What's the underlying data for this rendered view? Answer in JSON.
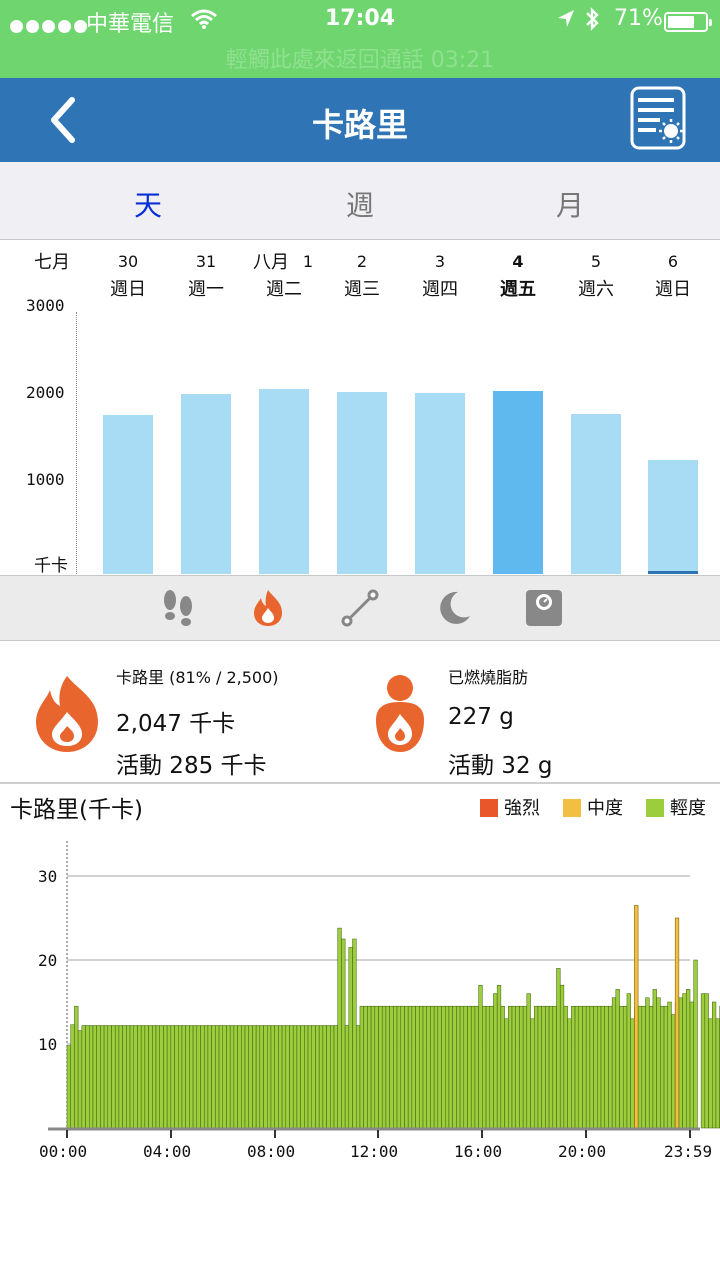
{
  "status_bar": {
    "carrier": "中華電信",
    "time": "17:04",
    "battery": "71%",
    "battery_level": 0.71,
    "call_banner": "輕觸此處來返回通話 03:21"
  },
  "header": {
    "title": "卡路里"
  },
  "tabs": [
    {
      "label": "天",
      "active": true
    },
    {
      "label": "週",
      "active": false
    },
    {
      "label": "月",
      "active": false
    }
  ],
  "week_chart": {
    "month_start": "七月",
    "month_mid": "八月",
    "days": [
      {
        "date": "30",
        "weekday": "週日"
      },
      {
        "date": "31",
        "weekday": "週一"
      },
      {
        "date": "1",
        "weekday": "週二"
      },
      {
        "date": "2",
        "weekday": "週三"
      },
      {
        "date": "3",
        "weekday": "週四"
      },
      {
        "date": "4",
        "weekday": "週五",
        "selected": true
      },
      {
        "date": "5",
        "weekday": "週六"
      },
      {
        "date": "6",
        "weekday": "週日"
      }
    ],
    "y_ticks": [
      "3000",
      "2000",
      "1000"
    ],
    "unit": "千卡"
  },
  "chart_data": [
    {
      "type": "bar",
      "categories": [
        "30 週日",
        "31 週一",
        "1 週二",
        "2 週三",
        "3 週四",
        "4 週五",
        "5 週六",
        "6 週日"
      ],
      "values": [
        1790,
        2030,
        2090,
        2050,
        2040,
        2060,
        1800,
        1290
      ],
      "ylim": [
        0,
        3000
      ],
      "ylabel": "千卡",
      "selected_index": 5,
      "colors": {
        "bar": "#a8dcf5",
        "selected": "#5fb8ee"
      }
    },
    {
      "type": "bar",
      "title": "卡路里(千卡)",
      "ylim": [
        0,
        35
      ],
      "y_ticks": [
        10,
        20,
        30
      ],
      "x_ticks": [
        "00:00",
        "04:00",
        "08:00",
        "12:00",
        "16:00",
        "20:00",
        "23:59"
      ],
      "series": [
        {
          "name": "強烈",
          "color": "#e8562a",
          "points": []
        },
        {
          "name": "中度",
          "color": "#f2c040",
          "points": [
            {
              "i": 153,
              "v": 26.5
            },
            {
              "i": 164,
              "v": 25.0
            }
          ]
        },
        {
          "name": "輕度",
          "color": "#9ccd3c",
          "values": [
            9.8,
            12.3,
            14.5,
            11.6,
            12.2,
            12.2,
            12.2,
            12.2,
            12.2,
            12.2,
            12.2,
            12.2,
            12.2,
            12.2,
            12.2,
            12.2,
            12.2,
            12.2,
            12.2,
            12.2,
            12.2,
            12.2,
            12.2,
            12.2,
            12.2,
            12.2,
            12.2,
            12.2,
            12.2,
            12.2,
            12.2,
            12.2,
            12.2,
            12.2,
            12.2,
            12.2,
            12.2,
            12.2,
            12.2,
            12.2,
            12.2,
            12.2,
            12.2,
            12.2,
            12.2,
            12.2,
            12.2,
            12.2,
            12.2,
            12.2,
            12.2,
            12.2,
            12.2,
            12.2,
            12.2,
            12.2,
            12.2,
            12.2,
            12.2,
            12.2,
            12.2,
            12.2,
            12.2,
            12.2,
            12.2,
            12.2,
            12.2,
            12.2,
            12.2,
            12.2,
            12.2,
            12.2,
            12.2,
            23.8,
            22.5,
            12.2,
            21.5,
            22.5,
            12.2,
            14.5,
            14.5,
            14.5,
            14.5,
            14.5,
            14.5,
            14.5,
            14.5,
            14.5,
            14.5,
            14.5,
            14.5,
            14.5,
            14.5,
            14.5,
            14.5,
            14.5,
            14.5,
            14.5,
            14.5,
            14.5,
            14.5,
            14.5,
            14.5,
            14.5,
            14.5,
            14.5,
            14.5,
            14.5,
            14.5,
            14.5,
            14.5,
            17.0,
            14.5,
            14.5,
            14.5,
            16.0,
            17.0,
            14.5,
            13.0,
            14.5,
            14.5,
            14.5,
            14.5,
            14.5,
            16.0,
            13.0,
            14.5,
            14.5,
            14.5,
            14.5,
            14.5,
            14.5,
            19.0,
            17.0,
            14.5,
            13.0,
            14.5,
            14.5,
            14.5,
            14.5,
            14.5,
            14.5,
            14.5,
            14.5,
            14.5,
            14.5,
            14.5,
            15.5,
            16.5,
            14.5,
            14.5,
            16.0,
            13.0,
            14.5,
            14.5,
            14.5,
            15.5,
            14.5,
            16.5,
            15.5,
            14.5,
            14.5,
            15.0,
            13.5,
            15.0,
            15.5,
            16.0,
            16.5,
            15.0,
            20.0,
            0,
            16.0,
            16.0,
            13.0,
            15.0,
            13.0,
            14.5,
            14.5,
            14.5,
            14.5,
            0,
            18.3
          ]
        }
      ]
    }
  ],
  "summary": {
    "calories_label": "卡路里 (81% / 2,500)",
    "calories_value": "2,047 千卡",
    "calories_activity": "活動 285 千卡",
    "fat_label": "已燃燒脂肪",
    "fat_value": "227 g",
    "fat_activity": "活動 32 g"
  },
  "daily_chart": {
    "title": "卡路里(千卡)",
    "legend": [
      {
        "name": "強烈",
        "color": "#e8562a"
      },
      {
        "name": "中度",
        "color": "#f2c040"
      },
      {
        "name": "輕度",
        "color": "#9ccd3c"
      }
    ],
    "y_ticks": [
      "30",
      "20",
      "10"
    ],
    "x_ticks": [
      "00:00",
      "04:00",
      "08:00",
      "12:00",
      "16:00",
      "20:00",
      "23:59"
    ]
  },
  "icons": {
    "back": "chevron-left-icon",
    "report": "report-settings-icon",
    "nav": [
      "footsteps-icon",
      "flame-icon",
      "distance-icon",
      "moon-icon",
      "scale-icon"
    ]
  },
  "colors": {
    "status_bar": "#6fd66f",
    "header": "#2f75b5",
    "tab_active": "#0a2fd6",
    "flame": "#e8652e"
  }
}
